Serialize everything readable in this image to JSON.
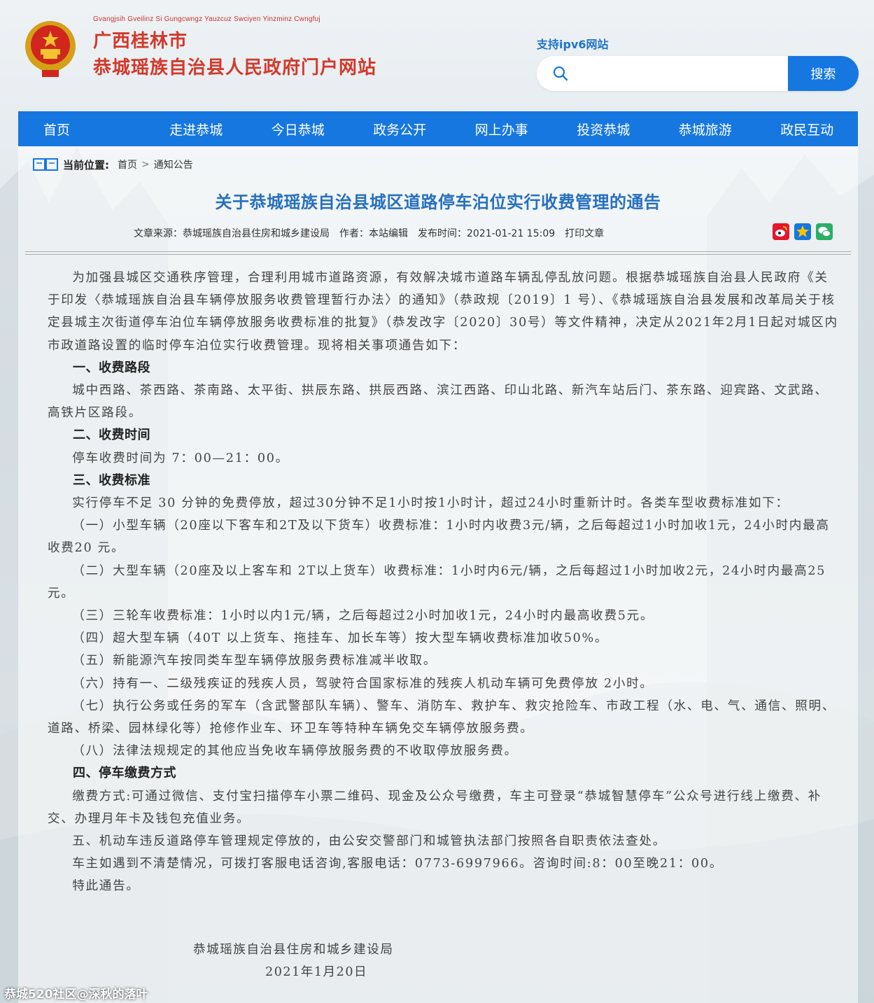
{
  "header": {
    "subtitle_pinyin": "Gvangjsih Gveilinz Si Gungcwngz Yauzcuz Swciyen Yinzminz Cwngfuj",
    "title_line1": "广西桂林市",
    "title_line2": "恭城瑶族自治县人民政府门户网站",
    "ipv6_label": "支持ipv6网站",
    "search_placeholder": "",
    "search_button": "搜索"
  },
  "nav": [
    "首页",
    "走进恭城",
    "今日恭城",
    "政务公开",
    "网上办事",
    "投资恭城",
    "恭城旅游",
    "政民互动"
  ],
  "breadcrumb": {
    "label": "当前位置:",
    "items": [
      "首页",
      "通知公告"
    ],
    "separator": ">"
  },
  "article": {
    "title": "关于恭城瑶族自治县城区道路停车泊位实行收费管理的通告",
    "source": "文章来源：恭城瑶族自治县住房和城乡建设局",
    "author": "作者：本站编辑",
    "published": "发布时间：2021-01-21 15:09",
    "print": "打印文章",
    "paragraphs": [
      {
        "type": "p",
        "text": "为加强县城区交通秩序管理，合理利用城市道路资源，有效解决城市道路车辆乱停乱放问题。根据恭城瑶族自治县人民政府《关于印发〈恭城瑶族自治县车辆停放服务收费管理暂行办法〉的通知》（恭政规〔2019〕1 号）、《恭城瑶族自治县发展和改革局关于核定县城主次街道停车泊位车辆停放服务收费标准的批复》（恭发改字〔2020〕30号）等文件精神，决定从2021年2月1日起对城区内市政道路设置的临时停车泊位实行收费管理。现将相关事项通告如下："
      },
      {
        "type": "h",
        "text": "一、收费路段"
      },
      {
        "type": "p",
        "text": "城中西路、茶西路、茶南路、太平街、拱辰东路、拱辰西路、滨江西路、印山北路、新汽车站后门、茶东路、迎宾路、文武路、高铁片区路段。"
      },
      {
        "type": "h",
        "text": "二、收费时间"
      },
      {
        "type": "p",
        "text": "停车收费时间为 7：00—21：00。"
      },
      {
        "type": "h",
        "text": "三、收费标准"
      },
      {
        "type": "p",
        "text": "实行停车不足 30 分钟的免费停放，超过30分钟不足1小时按1小时计，超过24小时重新计时。各类车型收费标准如下："
      },
      {
        "type": "p",
        "text": "（一）小型车辆（20座以下客车和2T及以下货车）收费标准：1小时内收费3元/辆，之后每超过1小时加收1元，24小时内最高收费20 元。"
      },
      {
        "type": "p",
        "text": "（二）大型车辆（20座及以上客车和 2T以上货车）收费标准：1小时内6元/辆，之后每超过1小时加收2元，24小时内最高25 元。"
      },
      {
        "type": "p",
        "text": "（三）三轮车收费标准：1小时以内1元/辆，之后每超过2小时加收1元，24小时内最高收费5元。"
      },
      {
        "type": "p",
        "text": "（四）超大型车辆（40T 以上货车、拖挂车、加长车等）按大型车辆收费标准加收50%。"
      },
      {
        "type": "p",
        "text": "（五）新能源汽车按同类车型车辆停放服务费标准减半收取。"
      },
      {
        "type": "p",
        "text": "（六）持有一、二级残疾证的残疾人员，驾驶符合国家标准的残疾人机动车辆可免费停放 2小时。"
      },
      {
        "type": "p",
        "text": "（七）执行公务或任务的军车（含武警部队车辆）、警车、消防车、救护车、救灾抢险车、市政工程（水、电、气、通信、照明、道路、桥梁、园林绿化等）抢修作业车、环卫车等特种车辆免交车辆停放服务费。"
      },
      {
        "type": "p",
        "text": "（八）法律法规规定的其他应当免收车辆停放服务费的不收取停放服务费。"
      },
      {
        "type": "h",
        "text": "四、停车缴费方式"
      },
      {
        "type": "p",
        "text": "缴费方式:可通过微信、支付宝扫描停车小票二维码、现金及公众号缴费，车主可登录“恭城智慧停车”公众号进行线上缴费、补交、办理月年卡及钱包充值业务。"
      },
      {
        "type": "p",
        "text": "五、机动车违反道路停车管理规定停放的，由公安交警部门和城管执法部门按照各自职责依法查处。"
      },
      {
        "type": "p",
        "text": "车主如遇到不清楚情况，可拨打客服电话咨询,客服电话：0773-6997966。咨询时间:8：00至晚21：00。"
      },
      {
        "type": "p",
        "text": "特此通告。"
      }
    ],
    "signature_org": "恭城瑶族自治县住房和城乡建设局",
    "signature_date": "2021年1月20日"
  },
  "watermark": "恭城520社区@深秋的落叶",
  "colors": {
    "nav_bg": "#1677e0",
    "title_red": "#d2392b",
    "article_title_blue": "#2770c0"
  }
}
